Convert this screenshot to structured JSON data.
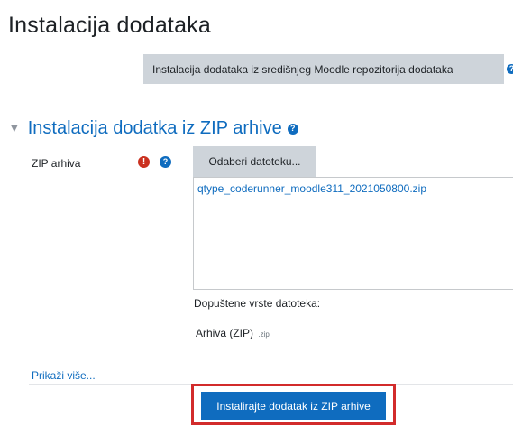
{
  "page": {
    "title": "Instalacija dodataka"
  },
  "repository": {
    "button_label": "Instalacija dodataka iz središnjeg Moodle repozitorija dodataka",
    "help_icon": "question-circle-icon"
  },
  "zip_section": {
    "title": "Instalacija dodatka iz ZIP arhive",
    "expanded": true,
    "field_label": "ZIP arhiva",
    "required": true,
    "choose_button_label": "Odaberi datoteku...",
    "selected_file": "qtype_coderunner_moodle311_2021050800.zip",
    "allowed_types_label": "Dopuštene vrste datoteka:",
    "allowed_type_name": "Arhiva (ZIP)",
    "allowed_type_ext": ".zip",
    "show_more_label": "Prikaži više...",
    "install_button_label": "Instalirajte dodatak iz ZIP arhive"
  },
  "colors": {
    "link": "#0f6cbf",
    "primary_button": "#0f6cbf",
    "secondary_button": "#ced4da",
    "required": "#ca3120",
    "highlight": "#d22b2b"
  }
}
